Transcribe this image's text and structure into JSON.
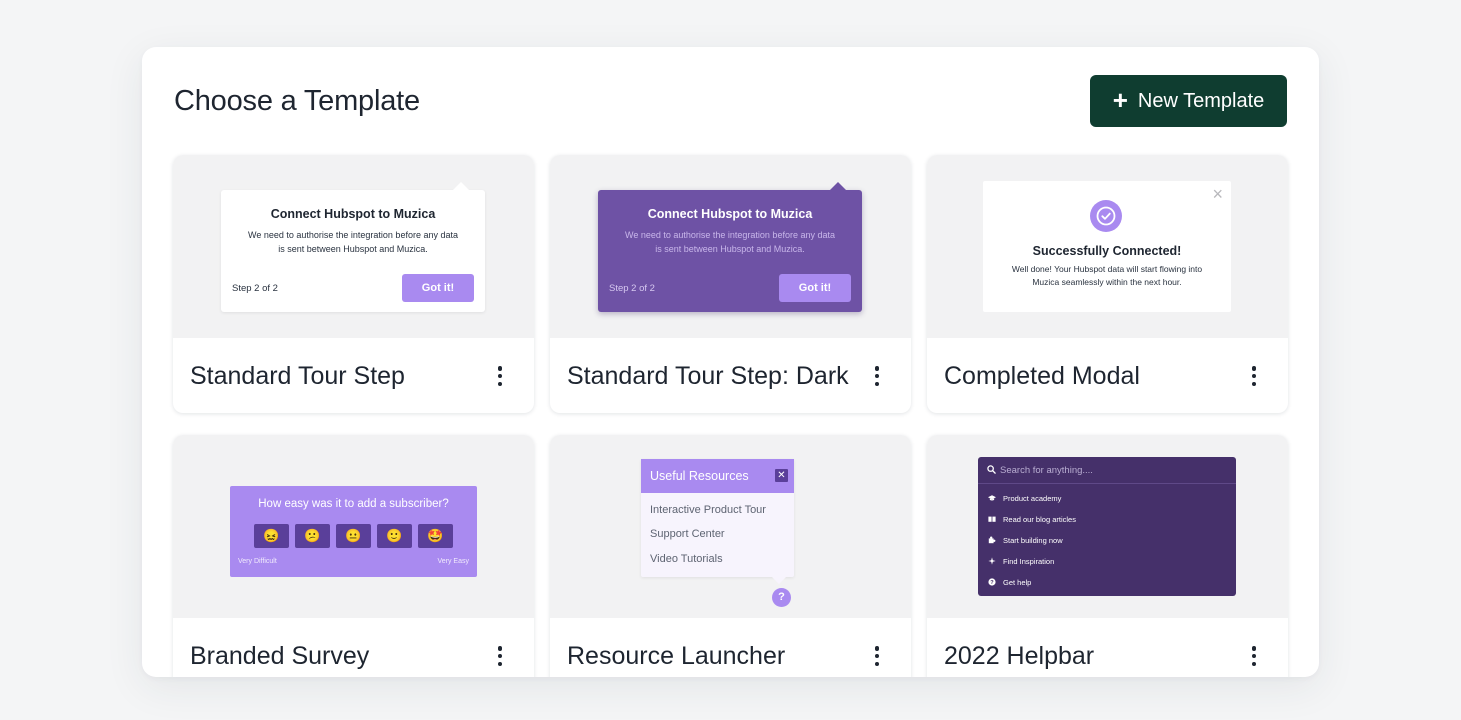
{
  "header": {
    "title": "Choose a Template",
    "new_button_icon": "plus-icon",
    "new_button_label": "New Template"
  },
  "colors": {
    "primary_button": "#0f3d30",
    "accent_purple": "#a98af0",
    "dark_purple": "#6e52a5",
    "helpbar_bg": "#45306a"
  },
  "templates": [
    {
      "title": "Standard Tour Step",
      "preview": {
        "heading": "Connect Hubspot to Muzica",
        "body": "We need to authorise the integration before any data is sent between Hubspot and Muzica.",
        "step": "Step 2 of 2",
        "button": "Got it!"
      }
    },
    {
      "title": "Standard Tour Step: Dark",
      "preview": {
        "heading": "Connect Hubspot to Muzica",
        "body": "We need to authorise the integration before any data is sent between Hubspot and Muzica.",
        "step": "Step 2 of 2",
        "button": "Got it!"
      }
    },
    {
      "title": "Completed Modal",
      "preview": {
        "close": "×",
        "heading": "Successfully Connected!",
        "body": "Well done! Your Hubspot data will start flowing into Muzica seamlessly within the next hour."
      }
    },
    {
      "title": "Branded Survey",
      "preview": {
        "question": "How easy was it to add a subscriber?",
        "emojis": [
          "😖",
          "😕",
          "😐",
          "🙂",
          "🤩"
        ],
        "low_label": "Very Difficult",
        "high_label": "Very Easy"
      }
    },
    {
      "title": "Resource Launcher",
      "preview": {
        "heading": "Useful Resources",
        "close": "✕",
        "items": [
          "Interactive Product Tour",
          "Support Center",
          "Video Tutorials"
        ],
        "launcher": "?"
      }
    },
    {
      "title": "2022 Helpbar",
      "preview": {
        "search_placeholder": "Search for anything....",
        "items": [
          {
            "icon": "graduation-cap-icon",
            "label": "Product academy"
          },
          {
            "icon": "book-icon",
            "label": "Read our blog articles"
          },
          {
            "icon": "puzzle-icon",
            "label": "Start building now"
          },
          {
            "icon": "sparkle-icon",
            "label": "Find Inspiration"
          },
          {
            "icon": "question-circle-icon",
            "label": "Get help"
          }
        ]
      }
    }
  ]
}
